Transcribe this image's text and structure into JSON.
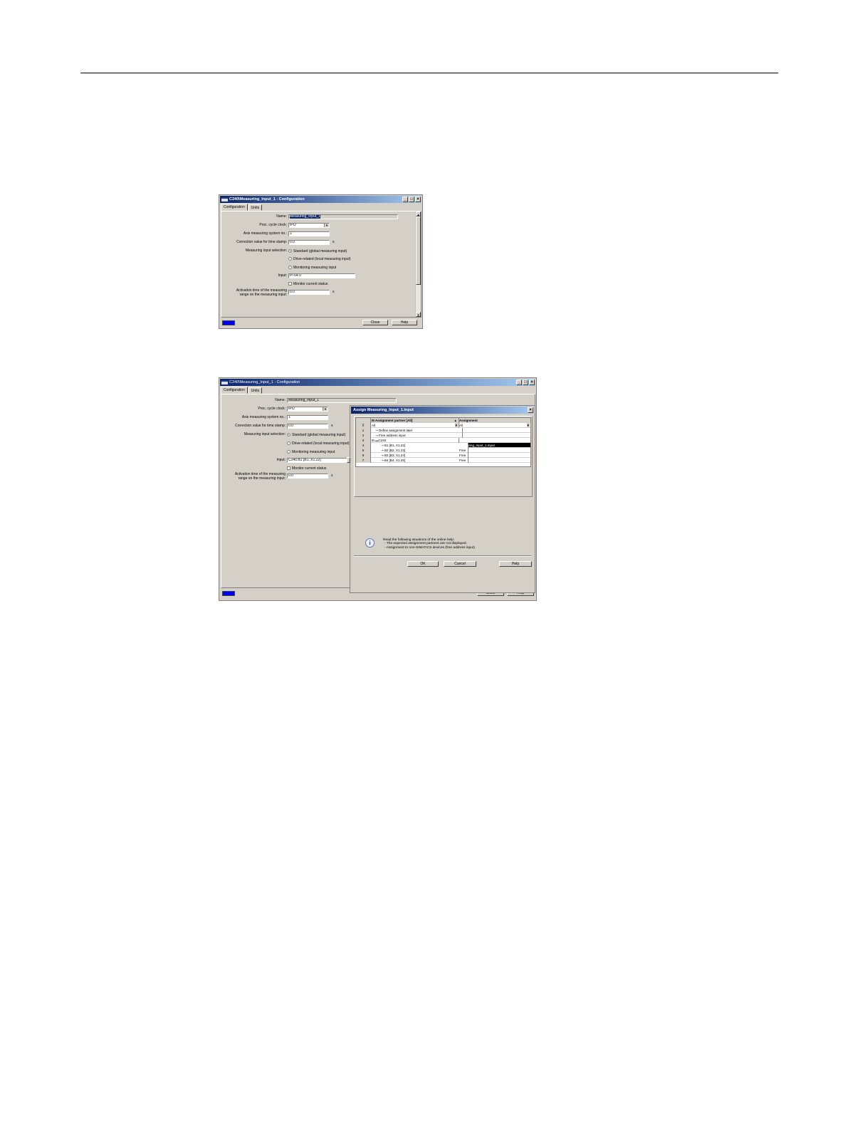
{
  "dialog1": {
    "title": "C240\\Measuring_Input_1 - Configuration",
    "tabs": [
      "Configuration",
      "Units"
    ],
    "fields": {
      "name_label": "Name:",
      "name_value": "Measuring_Input_1",
      "proc_label": "Proc. cycle clock:",
      "proc_value": "IPO",
      "axis_label": "Axis measuring system no.:",
      "axis_value": "1",
      "corr_label": "Correction value for time stamp:",
      "corr_value": "0.0",
      "corr_unit": "s",
      "sel_label": "Measuring input selection:",
      "opt_standard": "Standard (global measuring input)",
      "opt_drive": "Drive-related (local measuring input)",
      "opt_monitoring": "Monitoring measuring input",
      "input_label": "Input:",
      "input_value": "PI 64.0",
      "monitor_label": "Monitor current status",
      "act_label_1": "Activation time of the measuring",
      "act_label_2": "range on the measuring input:",
      "act_value": "0.0",
      "act_unit": "s"
    },
    "buttons": {
      "close": "Close",
      "help": "Help"
    }
  },
  "dialog2": {
    "title": "C240\\Measuring_Input_1 - Configuration",
    "tabs": [
      "Configuration",
      "Units"
    ],
    "fields": {
      "name_label": "Name:",
      "name_value": "Measuring_Input_1",
      "proc_label": "Proc. cycle clock:",
      "proc_value": "IPO",
      "axis_label": "Axis measuring system no.:",
      "axis_value": "1",
      "corr_label": "Correction value for time stamp:",
      "corr_value": "0.0",
      "corr_unit": "s",
      "sel_label": "Measuring input selection:",
      "opt_standard": "Standard (global measuring input)",
      "opt_drive": "Drive-related (local measuring input)",
      "opt_monitoring": "Monitoring measuring input",
      "input_label": "Input:",
      "input_value": "C240.B1 [B1, X1.22]",
      "monitor_label": "Monitor current status",
      "act_label_1": "Activation time of the measuring",
      "act_label_2": "range on the measuring input:",
      "act_value": "0.0",
      "act_unit": "s"
    },
    "buttons": {
      "close": "Close",
      "help": "Help"
    }
  },
  "assign": {
    "title": "Assign Measuring_Input_1.Input",
    "col1_header": "Assignment partner [All]",
    "col2_header": "Assignment",
    "filter1": "All",
    "filter2": "All",
    "rows": [
      {
        "num": "1",
        "partner": "Define assignment later",
        "assignment": ""
      },
      {
        "num": "2",
        "partner": "Free address input",
        "assignment": ""
      },
      {
        "num": "3",
        "partner": "C240",
        "assignment": ""
      },
      {
        "num": "4",
        "partner": "B1 [B1, X1.22]",
        "assignment": "Measuring_Input_1.Input"
      },
      {
        "num": "5",
        "partner": "B2 [B2, X1.23]",
        "assignment": "Free"
      },
      {
        "num": "6",
        "partner": "B3 [B3, X1.24]",
        "assignment": "Free"
      },
      {
        "num": "7",
        "partner": "B4 [B4, X1.25]",
        "assignment": "Free"
      }
    ],
    "note_1": "Read the following situations of the online help:",
    "note_2": "- The expected assignment partners are not displayed.",
    "note_3": "- Assignment to non-SIMATICS devices (free address input)",
    "buttons": {
      "ok": "OK",
      "cancel": "Cancel",
      "help": "Help"
    }
  },
  "icons": {
    "minimize": "_",
    "maximize": "□",
    "close": "×",
    "dropdown": "▼",
    "arrow_up": "▲",
    "arrow_down": "▼",
    "info": "i",
    "filter": "⊽",
    "sort": "▲",
    "link": "⇢",
    "collapse": "⊟",
    "device": "▬"
  }
}
